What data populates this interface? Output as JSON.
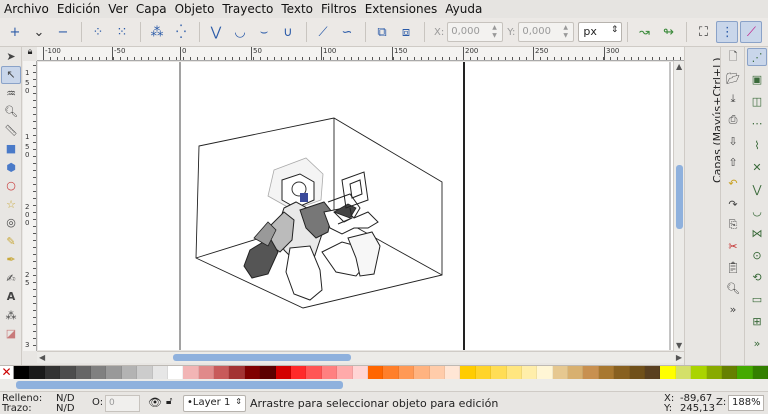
{
  "menubar": [
    "Archivo",
    "Edición",
    "Ver",
    "Capa",
    "Objeto",
    "Trayecto",
    "Texto",
    "Filtros",
    "Extensiones",
    "Ayuda"
  ],
  "toolbar": {
    "x_label": "X:",
    "x_value": "0,000",
    "y_label": "Y:",
    "y_value": "0,000",
    "unit": "px"
  },
  "ruler_top": [
    "-100",
    "-50",
    "0",
    "50",
    "100",
    "150",
    "200",
    "250",
    "300"
  ],
  "ruler_left": [
    "1",
    "5",
    "0",
    "1",
    "5",
    "0",
    "2",
    "0",
    "0",
    "2",
    "5",
    "3"
  ],
  "dock": {
    "tab_label": "Capas (Mayús+Ctrl+L)"
  },
  "palette": [
    "#000000",
    "#1a1a1a",
    "#333333",
    "#4d4d4d",
    "#666666",
    "#808080",
    "#999999",
    "#b3b3b3",
    "#cccccc",
    "#e6e6e6",
    "#ffffff",
    "#f2b5b5",
    "#e08a8a",
    "#c85a5a",
    "#a33333",
    "#800000",
    "#5c0000",
    "#d40000",
    "#ff2a2a",
    "#ff5555",
    "#ff8080",
    "#ffaaaa",
    "#ffd5d5",
    "#ff6600",
    "#ff7f2a",
    "#ff9955",
    "#ffb380",
    "#ffccaa",
    "#ffe6d5",
    "#ffcc00",
    "#ffd42a",
    "#ffdd55",
    "#ffe680",
    "#ffeeaa",
    "#fff6d5",
    "#e6c890",
    "#d8b070",
    "#c89050",
    "#a87830",
    "#886020",
    "#70501a",
    "#5a4020",
    "#ffff00",
    "#d4e06a",
    "#aad400",
    "#88aa00",
    "#668000",
    "#44aa00",
    "#338000"
  ],
  "status": {
    "fill_label": "Relleno:",
    "fill_value": "N/D",
    "stroke_label": "Trazo:",
    "stroke_value": "N/D",
    "opacity_label": "O:",
    "opacity_value": "0",
    "layer": "•Layer 1",
    "message": "Arrastre para seleccionar objeto para edición",
    "x_label": "X:",
    "x_value": "-89,67",
    "y_label": "Y:",
    "y_value": "245,13",
    "zoom_label": "Z:",
    "zoom_value": "188%"
  }
}
